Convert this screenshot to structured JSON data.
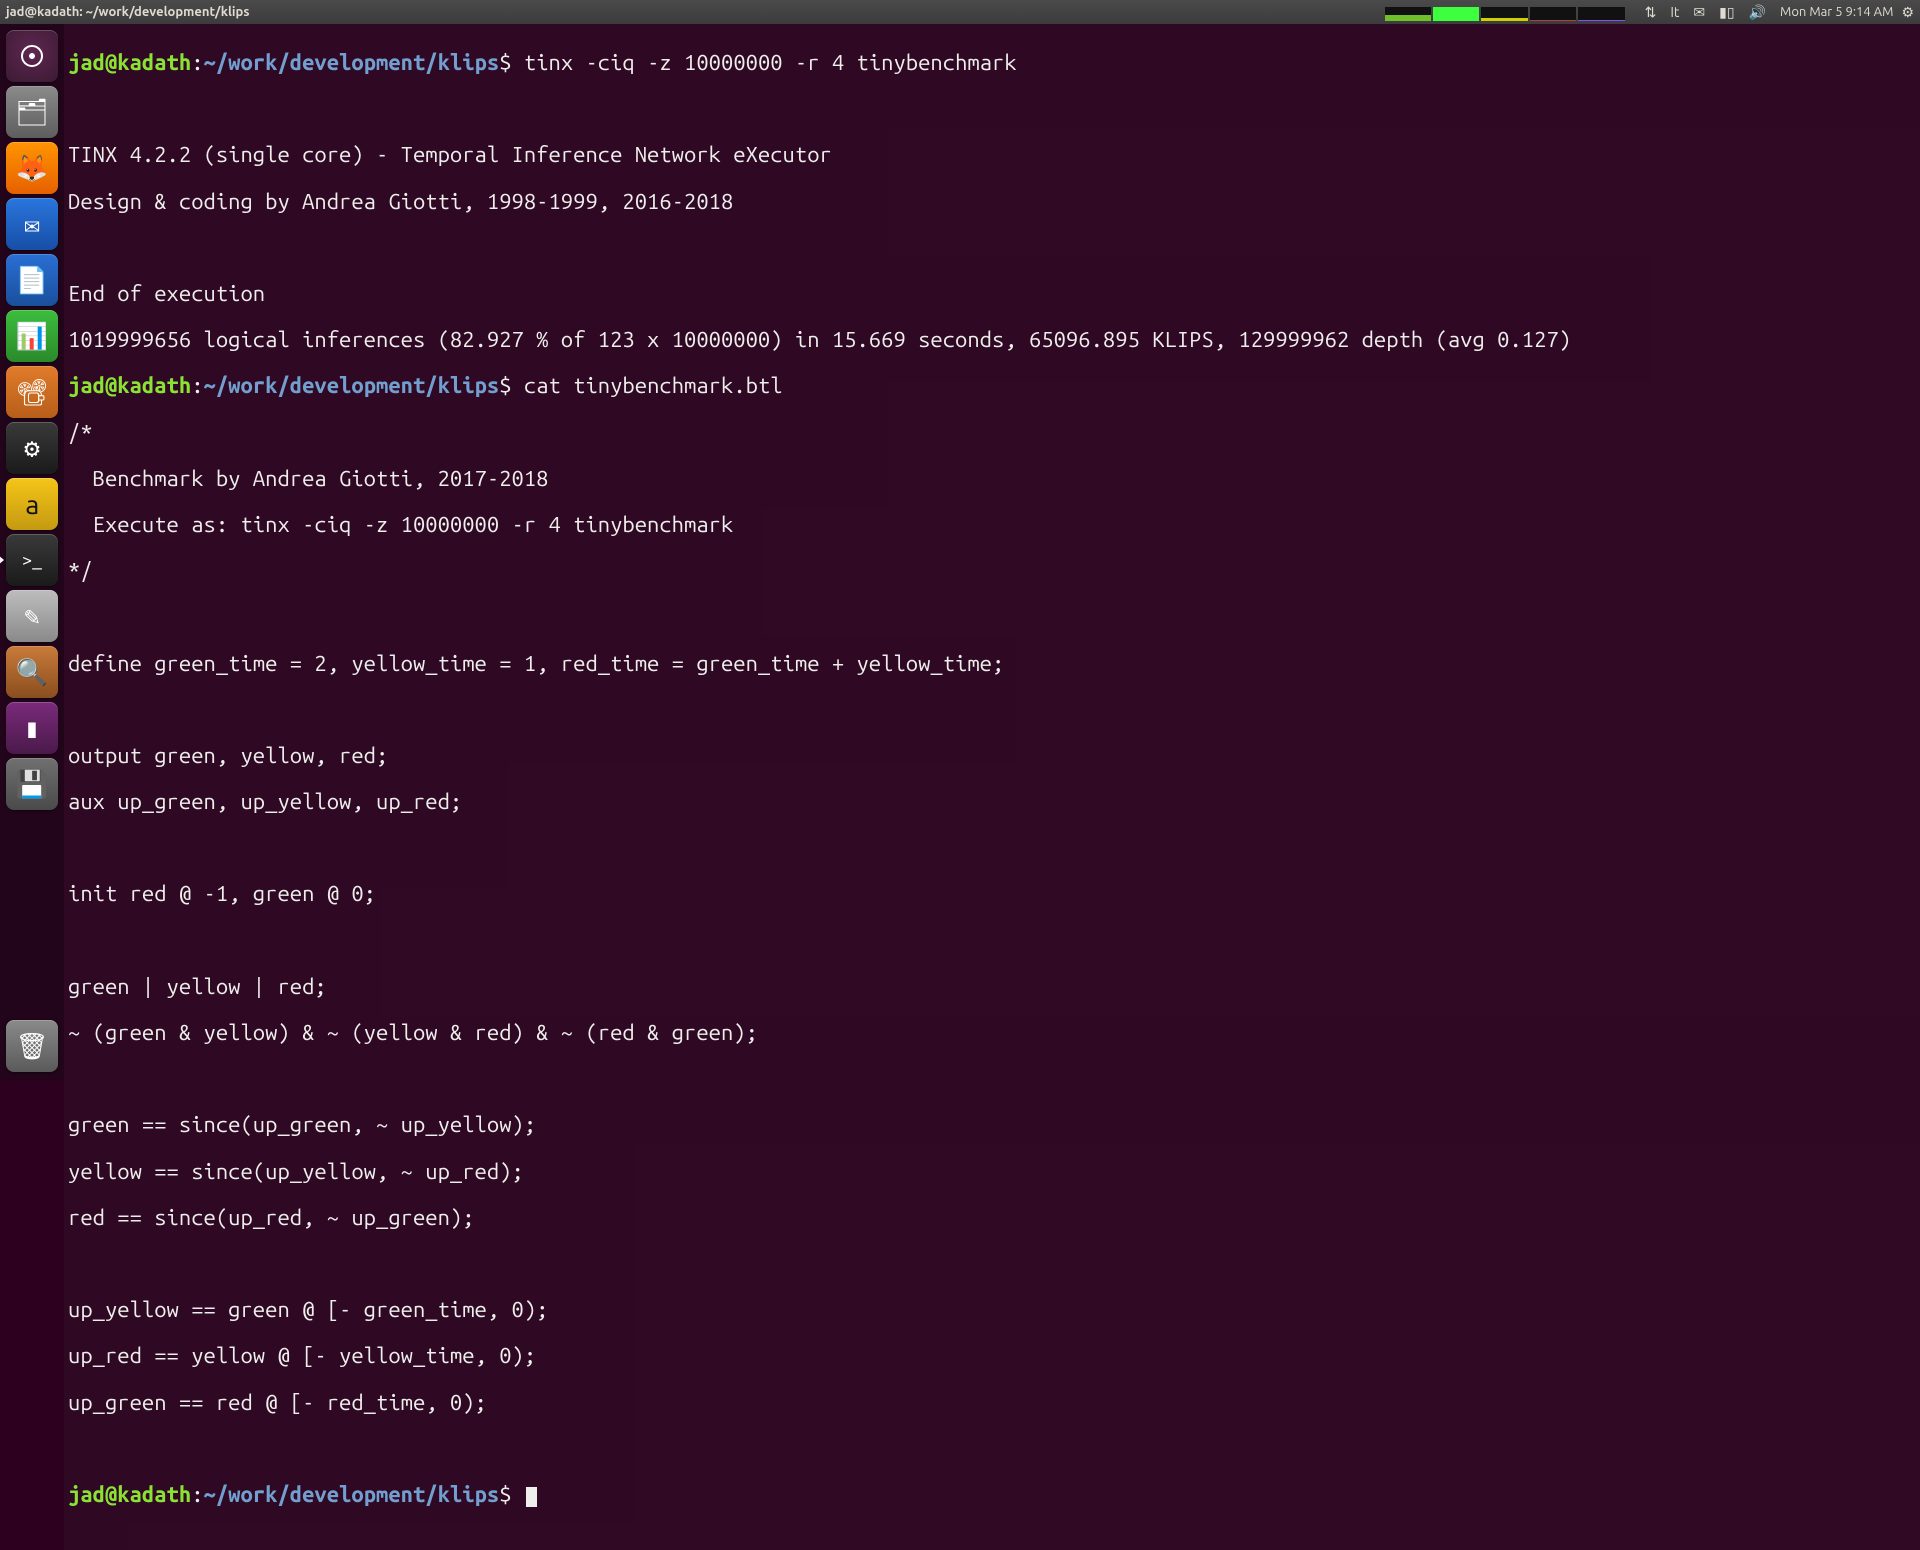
{
  "topbar": {
    "title": "jad@kadath: ~/work/development/klips",
    "clock": "Mon Mar 5  9:14 AM",
    "lang": "It"
  },
  "launcher": {
    "items": [
      {
        "name": "dash",
        "glyph": "◌"
      },
      {
        "name": "files",
        "glyph": "🗂"
      },
      {
        "name": "firefox",
        "glyph": "🦊"
      },
      {
        "name": "thunderbird",
        "glyph": "✉"
      },
      {
        "name": "writer",
        "glyph": "📄"
      },
      {
        "name": "calc",
        "glyph": "📊"
      },
      {
        "name": "impress",
        "glyph": "📽"
      },
      {
        "name": "device",
        "glyph": "⚙"
      },
      {
        "name": "amazon",
        "glyph": "a"
      },
      {
        "name": "terminal",
        "glyph": ">_"
      },
      {
        "name": "gedit",
        "glyph": "✎"
      },
      {
        "name": "search",
        "glyph": "🔍"
      },
      {
        "name": "purple",
        "glyph": "▮"
      },
      {
        "name": "drive",
        "glyph": "💾"
      },
      {
        "name": "trash",
        "glyph": "🗑"
      }
    ]
  },
  "term": {
    "prompt": {
      "user": "jad@kadath",
      "path": "~/work/development/klips",
      "sep": ":",
      "end": "$"
    },
    "cmd1": "tinx -ciq -z 10000000 -r 4 tinybenchmark",
    "out1a": "TINX 4.2.2 (single core) - Temporal Inference Network eXecutor",
    "out1b": "Design & coding by Andrea Giotti, 1998-1999, 2016-2018",
    "out1c": "End of execution",
    "out1d": "1019999656 logical inferences (82.927 % of 123 x 10000000) in 15.669 seconds, 65096.895 KLIPS, 129999962 depth (avg 0.127)",
    "cmd2": "cat tinybenchmark.btl",
    "file": {
      "l1": "/*",
      "l2": "  Benchmark by Andrea Giotti, 2017-2018",
      "l3": "  Execute as: tinx -ciq -z 10000000 -r 4 tinybenchmark",
      "l4": "*/",
      "l5": "define green_time = 2, yellow_time = 1, red_time = green_time + yellow_time;",
      "l6": "output green, yellow, red;",
      "l7": "aux up_green, up_yellow, up_red;",
      "l8": "init red @ -1, green @ 0;",
      "l9": "green | yellow | red;",
      "l10": "~ (green & yellow) & ~ (yellow & red) & ~ (red & green);",
      "l11": "green == since(up_green, ~ up_yellow);",
      "l12": "yellow == since(up_yellow, ~ up_red);",
      "l13": "red == since(up_red, ~ up_green);",
      "l14": "up_yellow == green @ [- green_time, 0);",
      "l15": "up_red == yellow @ [- yellow_time, 0);",
      "l16": "up_green == red @ [- red_time, 0);"
    }
  }
}
